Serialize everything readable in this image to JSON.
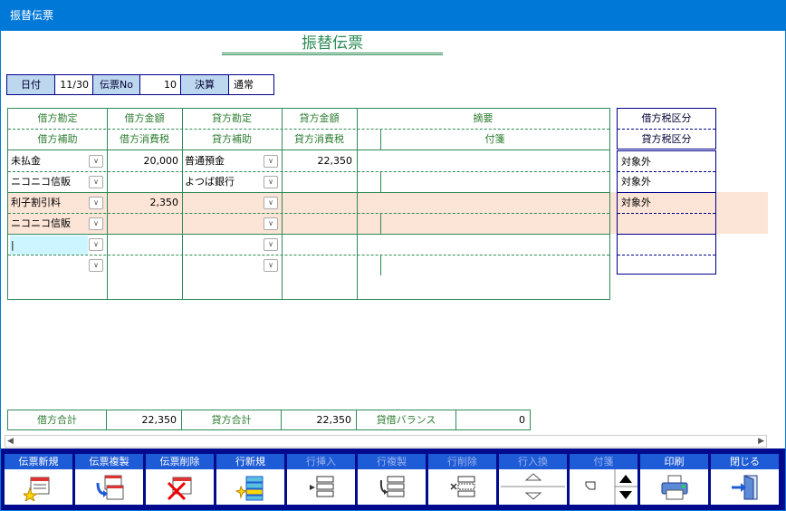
{
  "window": {
    "title": "振替伝票"
  },
  "heading": "振替伝票",
  "header": {
    "date_label": "日付",
    "date_value": "11/30",
    "voucher_label": "伝票No",
    "voucher_value": "10",
    "settle_label": "決算",
    "settle_value": "通常"
  },
  "columns": {
    "debit_account": "借方勘定",
    "debit_amount": "借方金額",
    "credit_account": "貸方勘定",
    "credit_amount": "貸方金額",
    "summary": "摘要",
    "debit_sub": "借方補助",
    "debit_tax": "借方消費税",
    "credit_sub": "貸方補助",
    "credit_tax": "貸方消費税",
    "tag": "付箋",
    "debit_tax_cat": "借方税区分",
    "credit_tax_cat": "貸方税区分"
  },
  "rows": [
    {
      "debit_account": "未払金",
      "debit_amount": "20,000",
      "credit_account": "普通預金",
      "credit_amount": "22,350",
      "debit_sub": "ニコニコ信販",
      "credit_sub": "よつば銀行",
      "debit_tax_cat": "対象外",
      "credit_tax_cat": "対象外"
    },
    {
      "debit_account": "利子割引料",
      "debit_amount": "2,350",
      "credit_account": "",
      "credit_amount": "",
      "debit_sub": "ニコニコ信販",
      "credit_sub": "",
      "debit_tax_cat": "対象外",
      "credit_tax_cat": ""
    },
    {
      "debit_account": "|",
      "debit_amount": "",
      "credit_account": "",
      "credit_amount": "",
      "debit_sub": "",
      "credit_sub": "",
      "debit_tax_cat": "",
      "credit_tax_cat": ""
    }
  ],
  "totals": {
    "debit_label": "借方合計",
    "debit_value": "22,350",
    "credit_label": "貸方合計",
    "credit_value": "22,350",
    "balance_label": "貸借バランス",
    "balance_value": "0"
  },
  "toolbar": [
    {
      "label": "伝票新規",
      "icon": "new-voucher-icon",
      "enabled": true
    },
    {
      "label": "伝票複製",
      "icon": "copy-voucher-icon",
      "enabled": true
    },
    {
      "label": "伝票削除",
      "icon": "delete-voucher-icon",
      "enabled": true
    },
    {
      "label": "行新規",
      "icon": "new-row-icon",
      "enabled": true
    },
    {
      "label": "行挿入",
      "icon": "insert-row-icon",
      "enabled": false
    },
    {
      "label": "行複製",
      "icon": "copy-row-icon",
      "enabled": false
    },
    {
      "label": "行削除",
      "icon": "delete-row-icon",
      "enabled": false
    },
    {
      "label": "行入換",
      "icon": "swap-row-icon",
      "enabled": false
    },
    {
      "label": "付箋",
      "icon": "tag-icon",
      "enabled": false
    },
    {
      "label": "印刷",
      "icon": "printer-icon",
      "enabled": true
    },
    {
      "label": "閉じる",
      "icon": "exit-door-icon",
      "enabled": true
    }
  ]
}
